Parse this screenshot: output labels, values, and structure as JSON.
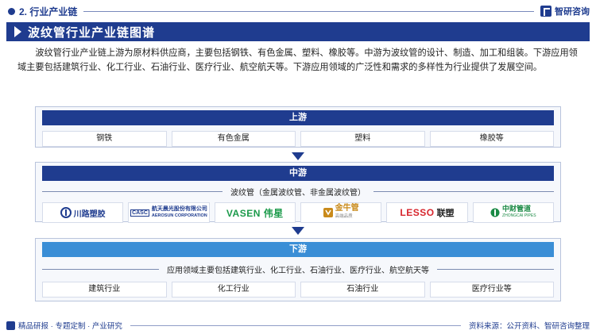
{
  "header": {
    "section_title": "2. 行业产业链",
    "brand": "智研咨询"
  },
  "title": "波纹管行业产业链图谱",
  "intro": "波纹管行业产业链上游为原材料供应商，主要包括钢铁、有色金属、塑料、橡胶等。中游为波纹管的设计、制造、加工和组装。下游应用领域主要包括建筑行业、化工行业、石油行业、医疗行业、航空航天等。下游应用领域的广泛性和需求的多样性为行业提供了发展空间。",
  "upstream": {
    "label": "上游",
    "items": [
      "钢铁",
      "有色金属",
      "塑料",
      "橡胶等"
    ]
  },
  "midstream": {
    "label": "中游",
    "subtitle": "波纹管（金属波纹管、非金属波纹管）",
    "logos": [
      {
        "name": "川路塑胶",
        "icon": "chuanlu-logo",
        "color": "#1f3c8f"
      },
      {
        "name": "航天晨光股份有限公司",
        "sub": "AEROSUN CORPORATION",
        "tag": "CASC",
        "icon": "casc-logo",
        "color": "#1f3c8f"
      },
      {
        "name": "VASEN 伟星",
        "icon": "vasen-logo",
        "color": "#1b9a4a"
      },
      {
        "name": "金牛管",
        "sub": "高端品质",
        "icon": "jinniu-logo",
        "color": "#c98a1a"
      },
      {
        "name": "LESSO联塑",
        "lesso": "LESSO",
        "lesso_cn": "联塑",
        "icon": "lesso-logo",
        "color": "#d7262d"
      },
      {
        "name": "中财管道",
        "sub": "ZHONGCAI PIPES",
        "icon": "zhongcai-logo",
        "color": "#1b8a45"
      }
    ]
  },
  "downstream": {
    "label": "下游",
    "subtitle": "应用领域主要包括建筑行业、化工行业、石油行业、医疗行业、航空航天等",
    "items": [
      "建筑行业",
      "化工行业",
      "石油行业",
      "医疗行业等"
    ]
  },
  "footer": {
    "left": "精品研报 · 专题定制 · 产业研究",
    "right": "资料来源：公开资料、智研咨询整理"
  }
}
